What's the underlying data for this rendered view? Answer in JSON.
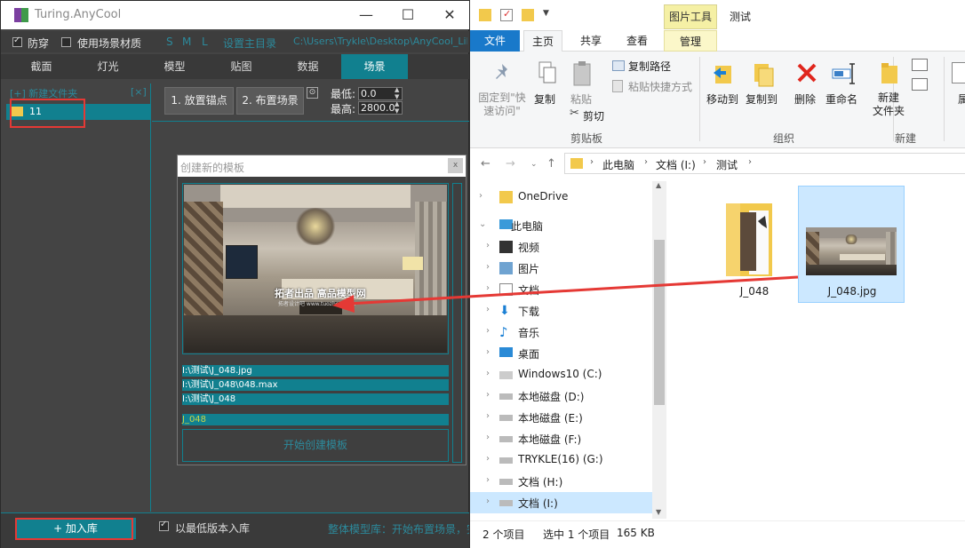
{
  "anycool": {
    "title": "Turing.AnyCool",
    "options": {
      "anti_penetrate": "防穿",
      "use_scene_material": "使用场景材质",
      "size_s": "S",
      "size_m": "M",
      "size_l": "L",
      "set_root": "设置主目录",
      "root_path": "C:\\Users\\Trykle\\Desktop\\AnyCool_Lib"
    },
    "tabs": [
      "截面",
      "灯光",
      "模型",
      "贴图",
      "数据",
      "场景"
    ],
    "active_tab": "场景",
    "left_panel": {
      "new_folder": "[+] 新建文件夹",
      "close": "[×]",
      "folders": [
        "11"
      ]
    },
    "actions": {
      "place_anchor": "1. 放置锚点",
      "layout_scene": "2. 布置场景",
      "min_label": "最低:",
      "min_value": "0.0",
      "max_label": "最高:",
      "max_value": "2800.0"
    },
    "dialog": {
      "title": "创建新的模板",
      "close": "x",
      "watermark": "拓者出品 高品模型网",
      "watermark_sub": "拓者设计吧 www.tuozhe8.com",
      "paths": [
        "I:\\测试\\J_048.jpg",
        "I:\\测试\\J_048\\048.max",
        "I:\\测试\\J_048"
      ],
      "name": "J_048",
      "start_button": "开始创建模板"
    },
    "footer": {
      "add_to_lib": "+ 加入库",
      "lowest_version": "以最低版本入库",
      "status": "整体模型库：开始布置场景，完"
    }
  },
  "explorer": {
    "picture_tools": "图片工具",
    "title": "测试",
    "tabs": {
      "file": "文件",
      "home": "主页",
      "share": "共享",
      "view": "查看",
      "manage": "管理"
    },
    "ribbon": {
      "pin": "固定到\"快\n速访问\"",
      "copy": "复制",
      "paste": "粘贴",
      "copy_path": "复制路径",
      "paste_shortcut": "粘贴快捷方式",
      "cut": "剪切",
      "clipboard_group": "剪贴板",
      "move_to": "移动到",
      "copy_to": "复制到",
      "delete": "删除",
      "rename": "重命名",
      "organize_group": "组织",
      "new_folder": "新建\n文件夹",
      "new_group": "新建",
      "properties": "属"
    },
    "address": {
      "crumbs": [
        "此电脑",
        "文档 (I:)",
        "测试"
      ]
    },
    "nav": [
      {
        "label": "OneDrive",
        "icon": "folder-icon"
      },
      {
        "label": "此电脑",
        "icon": "pc-icon"
      },
      {
        "label": "视频",
        "icon": "video-icon"
      },
      {
        "label": "图片",
        "icon": "pictures-icon"
      },
      {
        "label": "文档",
        "icon": "docs-icon"
      },
      {
        "label": "下载",
        "icon": "download-icon"
      },
      {
        "label": "音乐",
        "icon": "music-icon"
      },
      {
        "label": "桌面",
        "icon": "desktop-icon"
      },
      {
        "label": "Windows10 (C:)",
        "icon": "windows-drive-icon"
      },
      {
        "label": "本地磁盘 (D:)",
        "icon": "drive-icon"
      },
      {
        "label": "本地磁盘 (E:)",
        "icon": "drive-icon"
      },
      {
        "label": "本地磁盘 (F:)",
        "icon": "drive-icon"
      },
      {
        "label": "TRYKLE(16) (G:)",
        "icon": "drive-icon"
      },
      {
        "label": "文档 (H:)",
        "icon": "drive-icon"
      },
      {
        "label": "文档 (I:)",
        "icon": "drive-icon"
      }
    ],
    "files": [
      {
        "name": "J_048",
        "type": "folder"
      },
      {
        "name": "J_048.jpg",
        "type": "image"
      }
    ],
    "status": {
      "count": "2 个项目",
      "selected": "选中 1 个项目",
      "size": "165 KB"
    }
  }
}
